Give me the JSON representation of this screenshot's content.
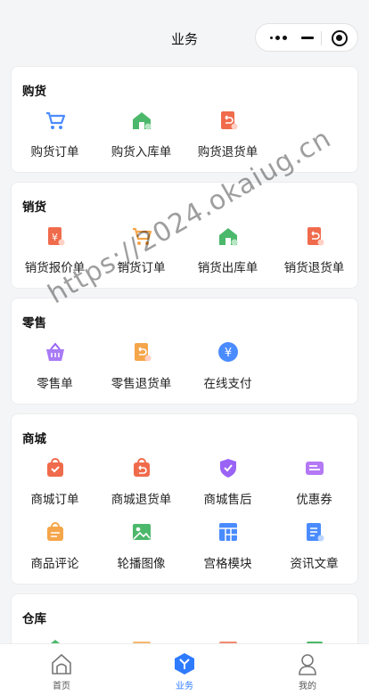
{
  "header": {
    "title": "业务",
    "capsule": [
      "more-icon",
      "minimize-icon",
      "record-icon"
    ]
  },
  "sections": [
    {
      "title": "购货",
      "items": [
        {
          "label": "购货订单",
          "icon": "cart-icon",
          "color": "#4a8bff"
        },
        {
          "label": "购货入库单",
          "icon": "warehouse-in-icon",
          "color": "#4cb86b"
        },
        {
          "label": "购货退货单",
          "icon": "return-doc-icon",
          "color": "#f06b4c"
        }
      ]
    },
    {
      "title": "销货",
      "items": [
        {
          "label": "销货报价单",
          "icon": "quote-doc-icon",
          "color": "#f06b4c"
        },
        {
          "label": "销货订单",
          "icon": "cart-icon",
          "color": "#f5a54a"
        },
        {
          "label": "销货出库单",
          "icon": "warehouse-out-icon",
          "color": "#4cb86b"
        },
        {
          "label": "销货退货单",
          "icon": "return-doc-icon",
          "color": "#f06b4c"
        }
      ]
    },
    {
      "title": "零售",
      "items": [
        {
          "label": "零售单",
          "icon": "basket-icon",
          "color": "#9a63f5"
        },
        {
          "label": "零售退货单",
          "icon": "return-doc-icon",
          "color": "#f5a54a"
        },
        {
          "label": "在线支付",
          "icon": "yen-coin-icon",
          "color": "#4a8bff"
        }
      ]
    },
    {
      "title": "商城",
      "items": [
        {
          "label": "商城订单",
          "icon": "shopping-bag-icon",
          "color": "#f06b4c"
        },
        {
          "label": "商城退货单",
          "icon": "return-bag-icon",
          "color": "#f06b4c"
        },
        {
          "label": "商城售后",
          "icon": "shield-check-icon",
          "color": "#9a63f5"
        },
        {
          "label": "优惠券",
          "icon": "coupon-icon",
          "color": "#b478f5"
        },
        {
          "label": "商品评论",
          "icon": "comment-bag-icon",
          "color": "#f5a54a"
        },
        {
          "label": "轮播图像",
          "icon": "image-icon",
          "color": "#4cb86b"
        },
        {
          "label": "宫格模块",
          "icon": "grid-module-icon",
          "color": "#4a8bff"
        },
        {
          "label": "资讯文章",
          "icon": "article-icon",
          "color": "#4a8bff"
        }
      ]
    },
    {
      "title": "仓库",
      "items": [
        {
          "label": "",
          "icon": "warehouse-icon",
          "color": "#4cb86b"
        },
        {
          "label": "",
          "icon": "box-icon",
          "color": "#f5a54a"
        },
        {
          "label": "",
          "icon": "box-icon",
          "color": "#f06b4c"
        },
        {
          "label": "",
          "icon": "doc-icon",
          "color": "#4cb86b"
        }
      ]
    }
  ],
  "tabs": [
    {
      "label": "首页",
      "icon": "home-icon",
      "active": false
    },
    {
      "label": "业务",
      "icon": "business-icon",
      "active": true
    },
    {
      "label": "我的",
      "icon": "user-icon",
      "active": false
    }
  ],
  "watermark": "https://2024.okaiug.cn"
}
